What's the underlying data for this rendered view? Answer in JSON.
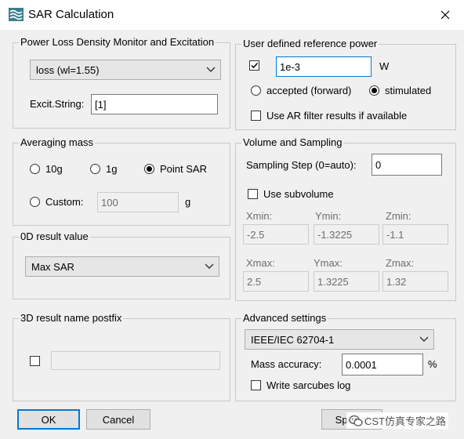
{
  "window": {
    "title": "SAR Calculation"
  },
  "power_loss": {
    "heading": "Power Loss Density Monitor and Excitation",
    "monitor_value": "loss (wl=1.55)",
    "excit_label": "Excit.String:",
    "excit_value": "[1]"
  },
  "averaging": {
    "heading": "Averaging mass",
    "options": [
      "10g",
      "1g",
      "Point SAR"
    ],
    "selected": "Point SAR",
    "custom_label": "Custom:",
    "custom_value": "100",
    "custom_unit": "g"
  },
  "result0d": {
    "heading": "0D result value",
    "value": "Max SAR"
  },
  "result3d": {
    "heading": "3D result name postfix",
    "value": ""
  },
  "reference_power": {
    "heading": "User defined reference power",
    "enabled": true,
    "value": "1e-3",
    "unit": "W",
    "accepted_label": "accepted (forward)",
    "stimulated_label": "stimulated",
    "selected": "stimulated",
    "ar_filter_label": "Use AR filter results if available",
    "ar_filter": false
  },
  "volume": {
    "heading": "Volume and Sampling",
    "sampling_label": "Sampling Step (0=auto):",
    "sampling_value": "0",
    "subvolume_label": "Use subvolume",
    "subvolume": false,
    "xmin_label": "Xmin:",
    "xmin": "-2.5",
    "ymin_label": "Ymin:",
    "ymin": "-1.3225",
    "zmin_label": "Zmin:",
    "zmin": "-1.1",
    "xmax_label": "Xmax:",
    "xmax": "2.5",
    "ymax_label": "Ymax:",
    "ymax": "1.3225",
    "zmax_label": "Zmax:",
    "zmax": "1.32"
  },
  "advanced": {
    "heading": "Advanced settings",
    "standard": "IEEE/IEC 62704-1",
    "mass_accuracy_label": "Mass accuracy:",
    "mass_accuracy": "0.0001",
    "mass_accuracy_unit": "%",
    "sarcubes_label": "Write sarcubes log",
    "sarcubes": false
  },
  "buttons": {
    "ok": "OK",
    "cancel": "Cancel",
    "special": "Special"
  },
  "watermark": {
    "text": "CST仿真专家之路"
  },
  "colors": {
    "focus": "#0078d7",
    "icon": "#3a7d8c",
    "background": "#f0f0f0"
  },
  "icons": {
    "app": "sar-wave-icon",
    "close": "close-icon",
    "chevron": "chevron-down-icon",
    "watermark": "wechat-icon"
  }
}
